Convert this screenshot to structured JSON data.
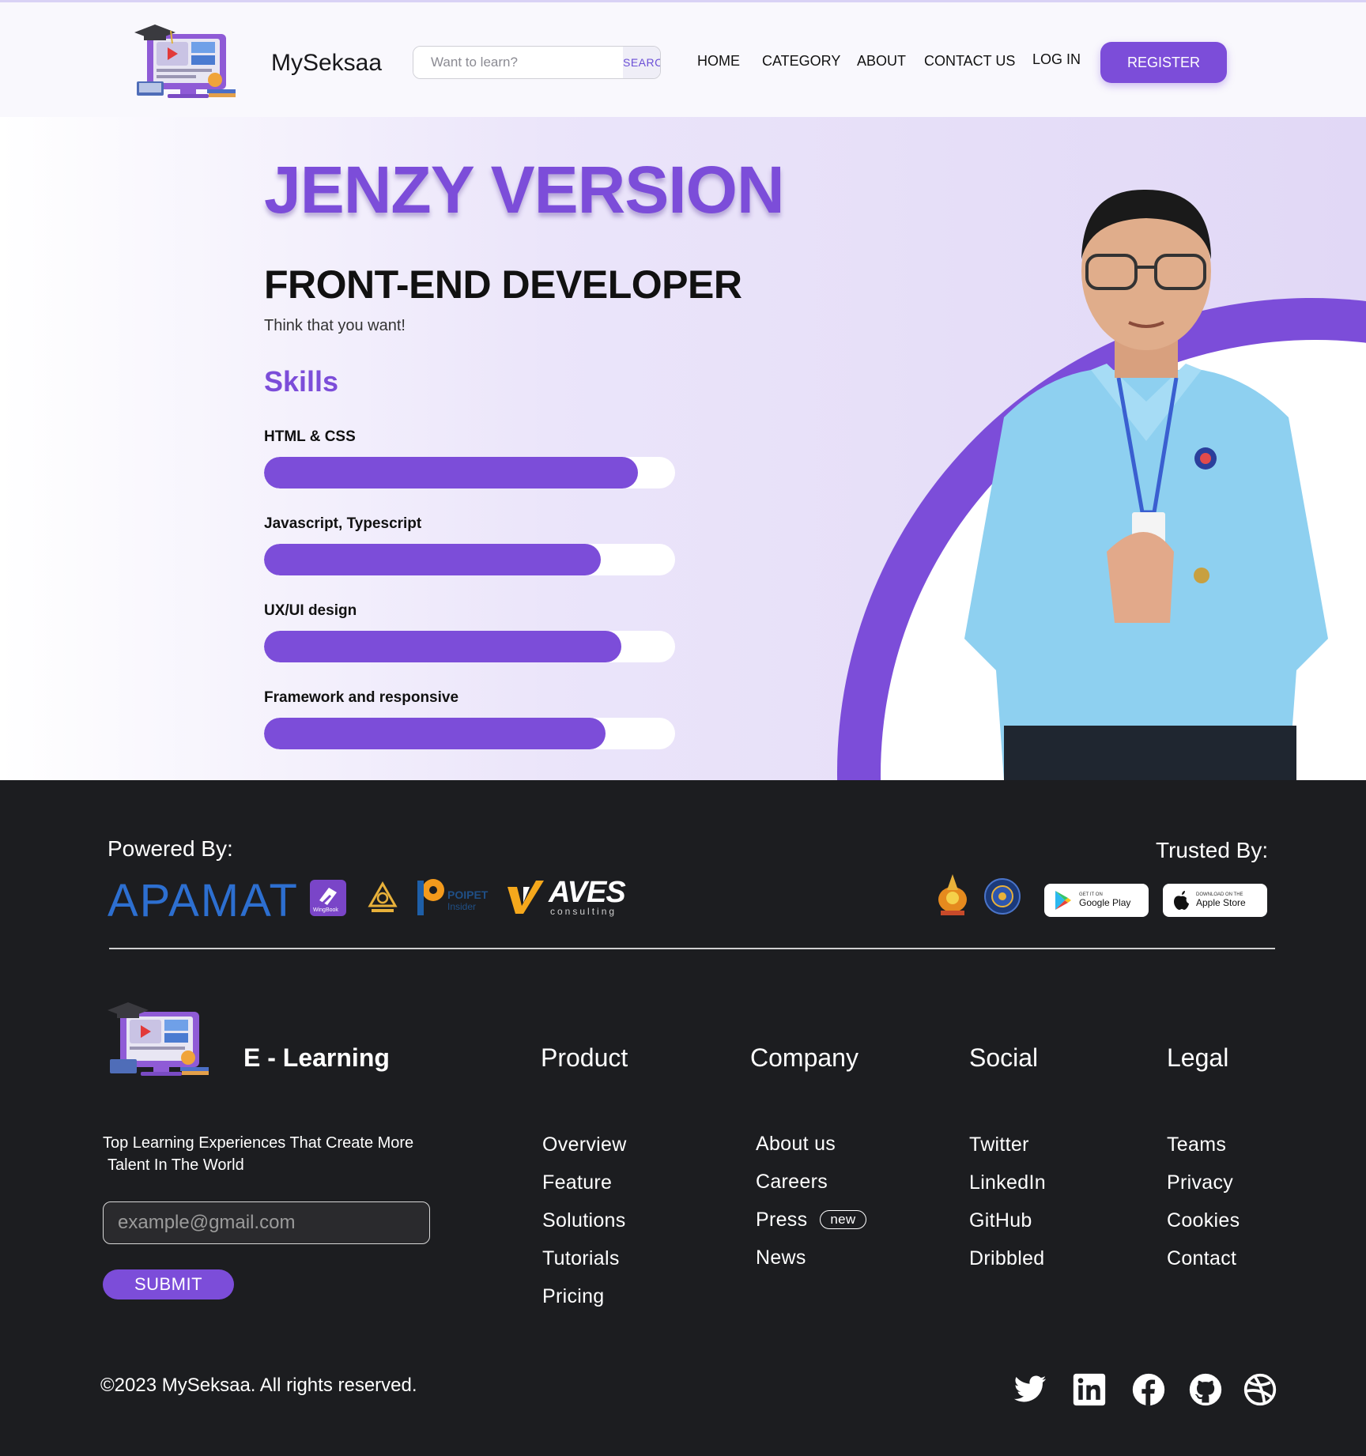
{
  "header": {
    "brand": "MySeksaa",
    "search": {
      "placeholder": "Want to learn?",
      "button": "SEARCH"
    },
    "nav": [
      "HOME",
      "CATEGORY",
      "ABOUT",
      "CONTACT US",
      "LOG IN"
    ],
    "register": "REGISTER"
  },
  "hero": {
    "title": "JENZY VERSION",
    "role": "FRONT-END DEVELOPER",
    "tagline": "Think that you want!",
    "skills_title": "Skills",
    "skills": [
      {
        "label": "HTML & CSS",
        "level": 0.91
      },
      {
        "label": "Javascript, Typescript",
        "level": 0.82
      },
      {
        "label": "UX/UI design",
        "level": 0.87
      },
      {
        "label": "Framework and responsive",
        "level": 0.83
      }
    ]
  },
  "footer": {
    "powered_by": "Powered By:",
    "trusted_by": "Trusted By:",
    "partners": {
      "apamat": "APAMAT",
      "wingbook": "WingBook",
      "aves": "AVES",
      "aves_sub": "consulting",
      "poipet": "POIPET",
      "poipet_sub": "Insider"
    },
    "stores": [
      {
        "small": "GET IT ON",
        "name": "Google Play",
        "icon": "google-play-icon"
      },
      {
        "small": "DOWNLOAD ON THE",
        "name": "Apple Store",
        "icon": "apple-icon"
      }
    ],
    "brand": "E - Learning",
    "tagline_line1": "Top Learning Experiences That Create More",
    "tagline_line2": "Talent In The World",
    "email_placeholder": "example@gmail.com",
    "submit": "SUBMIT",
    "columns": [
      {
        "heading": "Product",
        "links": [
          "Overview",
          "Feature",
          "Solutions",
          "Tutorials",
          "Pricing"
        ]
      },
      {
        "heading": "Company",
        "links": [
          "About us",
          "Careers",
          "Press",
          "News"
        ],
        "badge": "new"
      },
      {
        "heading": "Social",
        "links": [
          "Twitter",
          "LinkedIn",
          "GitHub",
          "Dribbled"
        ]
      },
      {
        "heading": "Legal",
        "links": [
          "Teams",
          "Privacy",
          "Cookies",
          "Contact"
        ]
      }
    ],
    "copyright": "©2023 MySeksaa. All rights reserved.",
    "social_icons": [
      "twitter-icon",
      "linkedin-icon",
      "facebook-icon",
      "github-icon",
      "dribbble-icon"
    ]
  },
  "colors": {
    "accent": "#7c4dd9",
    "footer_bg": "#1c1d20",
    "header_bg": "#f9f8fd"
  }
}
